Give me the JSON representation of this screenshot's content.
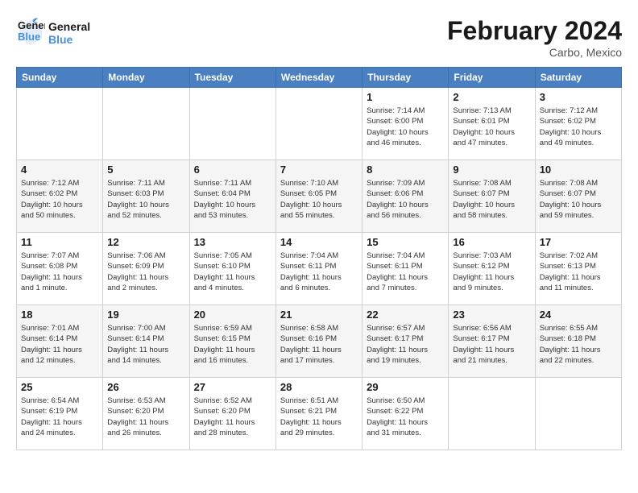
{
  "header": {
    "logo_line1": "General",
    "logo_line2": "Blue",
    "month_title": "February 2024",
    "location": "Carbo, Mexico"
  },
  "weekdays": [
    "Sunday",
    "Monday",
    "Tuesday",
    "Wednesday",
    "Thursday",
    "Friday",
    "Saturday"
  ],
  "weeks": [
    [
      {
        "day": "",
        "info": ""
      },
      {
        "day": "",
        "info": ""
      },
      {
        "day": "",
        "info": ""
      },
      {
        "day": "",
        "info": ""
      },
      {
        "day": "1",
        "info": "Sunrise: 7:14 AM\nSunset: 6:00 PM\nDaylight: 10 hours\nand 46 minutes."
      },
      {
        "day": "2",
        "info": "Sunrise: 7:13 AM\nSunset: 6:01 PM\nDaylight: 10 hours\nand 47 minutes."
      },
      {
        "day": "3",
        "info": "Sunrise: 7:12 AM\nSunset: 6:02 PM\nDaylight: 10 hours\nand 49 minutes."
      }
    ],
    [
      {
        "day": "4",
        "info": "Sunrise: 7:12 AM\nSunset: 6:02 PM\nDaylight: 10 hours\nand 50 minutes."
      },
      {
        "day": "5",
        "info": "Sunrise: 7:11 AM\nSunset: 6:03 PM\nDaylight: 10 hours\nand 52 minutes."
      },
      {
        "day": "6",
        "info": "Sunrise: 7:11 AM\nSunset: 6:04 PM\nDaylight: 10 hours\nand 53 minutes."
      },
      {
        "day": "7",
        "info": "Sunrise: 7:10 AM\nSunset: 6:05 PM\nDaylight: 10 hours\nand 55 minutes."
      },
      {
        "day": "8",
        "info": "Sunrise: 7:09 AM\nSunset: 6:06 PM\nDaylight: 10 hours\nand 56 minutes."
      },
      {
        "day": "9",
        "info": "Sunrise: 7:08 AM\nSunset: 6:07 PM\nDaylight: 10 hours\nand 58 minutes."
      },
      {
        "day": "10",
        "info": "Sunrise: 7:08 AM\nSunset: 6:07 PM\nDaylight: 10 hours\nand 59 minutes."
      }
    ],
    [
      {
        "day": "11",
        "info": "Sunrise: 7:07 AM\nSunset: 6:08 PM\nDaylight: 11 hours\nand 1 minute."
      },
      {
        "day": "12",
        "info": "Sunrise: 7:06 AM\nSunset: 6:09 PM\nDaylight: 11 hours\nand 2 minutes."
      },
      {
        "day": "13",
        "info": "Sunrise: 7:05 AM\nSunset: 6:10 PM\nDaylight: 11 hours\nand 4 minutes."
      },
      {
        "day": "14",
        "info": "Sunrise: 7:04 AM\nSunset: 6:11 PM\nDaylight: 11 hours\nand 6 minutes."
      },
      {
        "day": "15",
        "info": "Sunrise: 7:04 AM\nSunset: 6:11 PM\nDaylight: 11 hours\nand 7 minutes."
      },
      {
        "day": "16",
        "info": "Sunrise: 7:03 AM\nSunset: 6:12 PM\nDaylight: 11 hours\nand 9 minutes."
      },
      {
        "day": "17",
        "info": "Sunrise: 7:02 AM\nSunset: 6:13 PM\nDaylight: 11 hours\nand 11 minutes."
      }
    ],
    [
      {
        "day": "18",
        "info": "Sunrise: 7:01 AM\nSunset: 6:14 PM\nDaylight: 11 hours\nand 12 minutes."
      },
      {
        "day": "19",
        "info": "Sunrise: 7:00 AM\nSunset: 6:14 PM\nDaylight: 11 hours\nand 14 minutes."
      },
      {
        "day": "20",
        "info": "Sunrise: 6:59 AM\nSunset: 6:15 PM\nDaylight: 11 hours\nand 16 minutes."
      },
      {
        "day": "21",
        "info": "Sunrise: 6:58 AM\nSunset: 6:16 PM\nDaylight: 11 hours\nand 17 minutes."
      },
      {
        "day": "22",
        "info": "Sunrise: 6:57 AM\nSunset: 6:17 PM\nDaylight: 11 hours\nand 19 minutes."
      },
      {
        "day": "23",
        "info": "Sunrise: 6:56 AM\nSunset: 6:17 PM\nDaylight: 11 hours\nand 21 minutes."
      },
      {
        "day": "24",
        "info": "Sunrise: 6:55 AM\nSunset: 6:18 PM\nDaylight: 11 hours\nand 22 minutes."
      }
    ],
    [
      {
        "day": "25",
        "info": "Sunrise: 6:54 AM\nSunset: 6:19 PM\nDaylight: 11 hours\nand 24 minutes."
      },
      {
        "day": "26",
        "info": "Sunrise: 6:53 AM\nSunset: 6:20 PM\nDaylight: 11 hours\nand 26 minutes."
      },
      {
        "day": "27",
        "info": "Sunrise: 6:52 AM\nSunset: 6:20 PM\nDaylight: 11 hours\nand 28 minutes."
      },
      {
        "day": "28",
        "info": "Sunrise: 6:51 AM\nSunset: 6:21 PM\nDaylight: 11 hours\nand 29 minutes."
      },
      {
        "day": "29",
        "info": "Sunrise: 6:50 AM\nSunset: 6:22 PM\nDaylight: 11 hours\nand 31 minutes."
      },
      {
        "day": "",
        "info": ""
      },
      {
        "day": "",
        "info": ""
      }
    ]
  ]
}
